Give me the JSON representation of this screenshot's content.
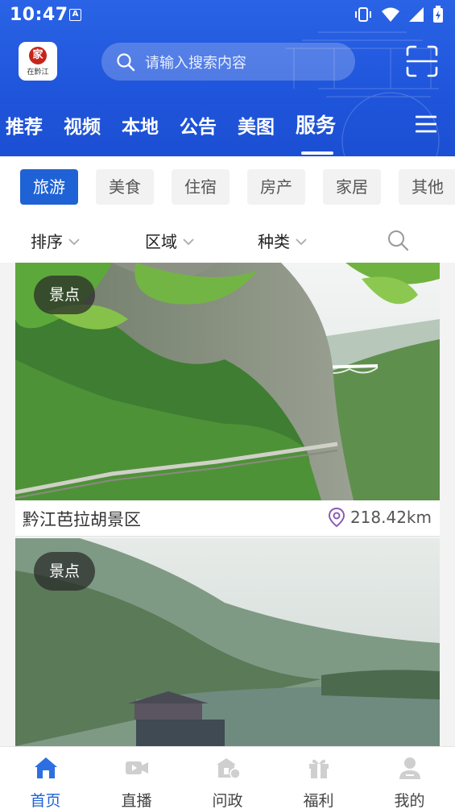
{
  "status_bar": {
    "time": "10:47",
    "app_badge": "A",
    "icons": [
      "vibrate-icon",
      "wifi-icon",
      "signal-icon",
      "battery-icon"
    ]
  },
  "header": {
    "logo_text": "在黔江",
    "logo_seal": "家",
    "search_placeholder": "请输入搜索内容",
    "tabs": [
      {
        "label": "推荐",
        "active": false
      },
      {
        "label": "视频",
        "active": false
      },
      {
        "label": "本地",
        "active": false
      },
      {
        "label": "公告",
        "active": false
      },
      {
        "label": "美图",
        "active": false
      },
      {
        "label": "服务",
        "active": true
      }
    ]
  },
  "categories": [
    {
      "label": "旅游",
      "active": true
    },
    {
      "label": "美食",
      "active": false
    },
    {
      "label": "住宿",
      "active": false
    },
    {
      "label": "房产",
      "active": false
    },
    {
      "label": "家居",
      "active": false
    },
    {
      "label": "其他",
      "active": false
    }
  ],
  "filters": [
    {
      "label": "排序"
    },
    {
      "label": "区域"
    },
    {
      "label": "种类"
    }
  ],
  "feed": [
    {
      "tag": "景点",
      "title": "黔江芭拉胡景区",
      "distance": "218.42km"
    },
    {
      "tag": "景点",
      "title": "",
      "distance": ""
    }
  ],
  "bottom_nav": [
    {
      "label": "首页",
      "icon": "home-icon",
      "active": true
    },
    {
      "label": "直播",
      "icon": "video-camera-icon",
      "active": false
    },
    {
      "label": "问政",
      "icon": "government-chat-icon",
      "active": false
    },
    {
      "label": "福利",
      "icon": "gift-icon",
      "active": false
    },
    {
      "label": "我的",
      "icon": "user-icon",
      "active": false
    }
  ],
  "colors": {
    "header_blue": "#1f55db",
    "accent_blue": "#1f62d6",
    "location_purple": "#8b5bb5"
  }
}
